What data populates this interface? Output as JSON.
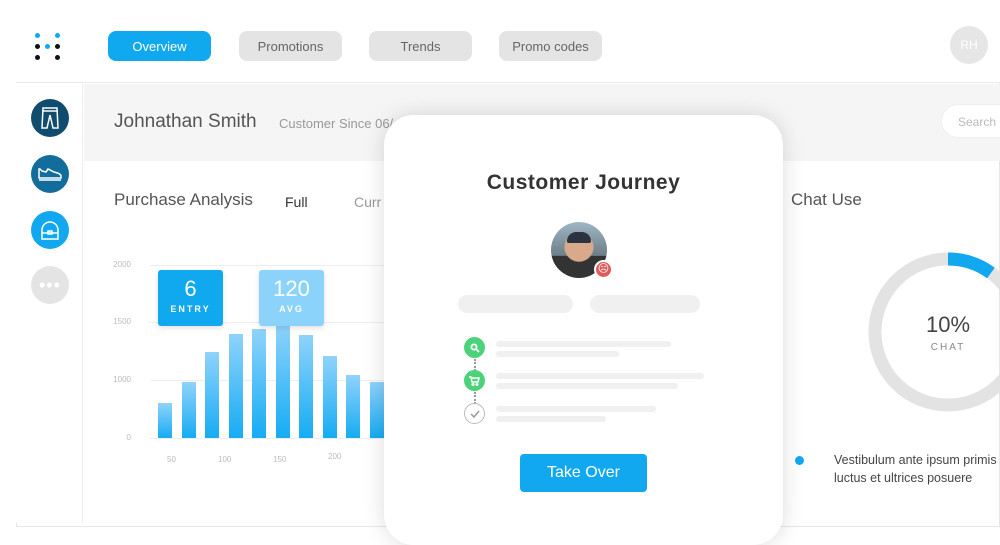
{
  "nav": {
    "tabs": [
      {
        "label": "Overview",
        "active": true
      },
      {
        "label": "Promotions"
      },
      {
        "label": "Trends"
      },
      {
        "label": "Promo codes"
      }
    ],
    "user_initials": "RH"
  },
  "sidebar": {
    "items": [
      {
        "icon": "pants-icon",
        "color": "#0f4c6e"
      },
      {
        "icon": "shoe-icon",
        "color": "#136d9c"
      },
      {
        "icon": "bag-icon",
        "color": "#12a8ef"
      },
      {
        "icon": "more-icon",
        "color": "#e4e4e4"
      }
    ]
  },
  "customer": {
    "name": "Johnathan Smith",
    "since": "Customer Since 06/",
    "search_placeholder": "Search"
  },
  "purchase": {
    "title": "Purchase Analysis",
    "filters": [
      "Full",
      "Curr"
    ],
    "kpis": [
      {
        "value": "6",
        "label": "ENTRY",
        "color": "#10a9f0"
      },
      {
        "value": "120",
        "label": "AVG",
        "color": "#8cd3fb"
      }
    ]
  },
  "chart_data": {
    "type": "bar",
    "ylim": [
      0,
      2000
    ],
    "yticks": [
      "0",
      "1000",
      "1500",
      "2000"
    ],
    "xticks": [
      "50",
      "100",
      "150",
      "200"
    ],
    "values": [
      400,
      650,
      1000,
      1200,
      1260,
      1320,
      1190,
      950,
      730,
      650
    ]
  },
  "modal": {
    "title": "Customer Journey",
    "mood": "sad",
    "steps": [
      {
        "icon": "search-icon",
        "color": "#4cd37a"
      },
      {
        "icon": "cart-icon",
        "color": "#4cd37a"
      },
      {
        "icon": "check-icon",
        "color": "#ffffff"
      }
    ],
    "button": "Take Over"
  },
  "chat": {
    "title": "Chat Use",
    "percent": 10,
    "percent_label": "10%",
    "label": "CHAT",
    "accent": "#12a8ef",
    "legend": [
      "Vestibulum ante ipsum primis",
      "luctus et ultrices posuere"
    ]
  }
}
